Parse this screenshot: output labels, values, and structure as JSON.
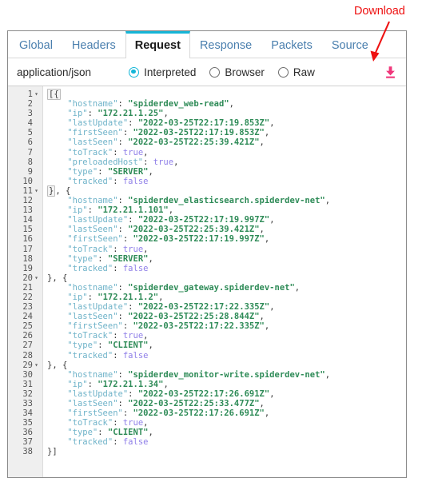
{
  "annotation": {
    "label": "Download",
    "color": "#ee1111"
  },
  "tabs": [
    {
      "label": "Global",
      "active": false
    },
    {
      "label": "Headers",
      "active": false
    },
    {
      "label": "Request",
      "active": true
    },
    {
      "label": "Response",
      "active": false
    },
    {
      "label": "Packets",
      "active": false
    },
    {
      "label": "Source",
      "active": false
    }
  ],
  "options": {
    "content_type": "application/json",
    "radios": [
      {
        "label": "Interpreted",
        "selected": true
      },
      {
        "label": "Browser",
        "selected": false
      },
      {
        "label": "Raw",
        "selected": false
      }
    ],
    "download_icon": "download-icon",
    "download_icon_color": "#f0367a"
  },
  "theme": {
    "accent": "#16b5d6",
    "tab_inactive_text": "#4a7fae",
    "tab_active_text": "#1b1b1b",
    "key_color": "#6fb3c9",
    "string_color": "#2e8b57",
    "bool_color": "#8f7fe8",
    "gutter_bg": "#efefef",
    "panel_border": "#8a8a8a"
  },
  "code": {
    "language": "json",
    "total_lines": 38,
    "lines": [
      {
        "n": 1,
        "fold": true,
        "indent": 0,
        "tokens": [
          {
            "t": "punct",
            "v": "[{",
            "boxed": true
          }
        ]
      },
      {
        "n": 2,
        "fold": false,
        "indent": 4,
        "tokens": [
          {
            "t": "key",
            "v": "\"hostname\""
          },
          {
            "t": "punct",
            "v": ": "
          },
          {
            "t": "string",
            "v": "\"spiderdev_web-read\""
          },
          {
            "t": "punct",
            "v": ","
          }
        ]
      },
      {
        "n": 3,
        "fold": false,
        "indent": 4,
        "tokens": [
          {
            "t": "key",
            "v": "\"ip\""
          },
          {
            "t": "punct",
            "v": ": "
          },
          {
            "t": "string",
            "v": "\"172.21.1.25\""
          },
          {
            "t": "punct",
            "v": ","
          }
        ]
      },
      {
        "n": 4,
        "fold": false,
        "indent": 4,
        "tokens": [
          {
            "t": "key",
            "v": "\"lastUpdate\""
          },
          {
            "t": "punct",
            "v": ": "
          },
          {
            "t": "string",
            "v": "\"2022-03-25T22:17:19.853Z\""
          },
          {
            "t": "punct",
            "v": ","
          }
        ]
      },
      {
        "n": 5,
        "fold": false,
        "indent": 4,
        "tokens": [
          {
            "t": "key",
            "v": "\"firstSeen\""
          },
          {
            "t": "punct",
            "v": ": "
          },
          {
            "t": "string",
            "v": "\"2022-03-25T22:17:19.853Z\""
          },
          {
            "t": "punct",
            "v": ","
          }
        ]
      },
      {
        "n": 6,
        "fold": false,
        "indent": 4,
        "tokens": [
          {
            "t": "key",
            "v": "\"lastSeen\""
          },
          {
            "t": "punct",
            "v": ": "
          },
          {
            "t": "string",
            "v": "\"2022-03-25T22:25:39.421Z\""
          },
          {
            "t": "punct",
            "v": ","
          }
        ]
      },
      {
        "n": 7,
        "fold": false,
        "indent": 4,
        "tokens": [
          {
            "t": "key",
            "v": "\"toTrack\""
          },
          {
            "t": "punct",
            "v": ": "
          },
          {
            "t": "bool",
            "v": "true"
          },
          {
            "t": "punct",
            "v": ","
          }
        ]
      },
      {
        "n": 8,
        "fold": false,
        "indent": 4,
        "tokens": [
          {
            "t": "key",
            "v": "\"preloadedHost\""
          },
          {
            "t": "punct",
            "v": ": "
          },
          {
            "t": "bool",
            "v": "true"
          },
          {
            "t": "punct",
            "v": ","
          }
        ]
      },
      {
        "n": 9,
        "fold": false,
        "indent": 4,
        "tokens": [
          {
            "t": "key",
            "v": "\"type\""
          },
          {
            "t": "punct",
            "v": ": "
          },
          {
            "t": "string",
            "v": "\"SERVER\""
          },
          {
            "t": "punct",
            "v": ","
          }
        ]
      },
      {
        "n": 10,
        "fold": false,
        "indent": 4,
        "tokens": [
          {
            "t": "key",
            "v": "\"tracked\""
          },
          {
            "t": "punct",
            "v": ": "
          },
          {
            "t": "bool",
            "v": "false"
          }
        ]
      },
      {
        "n": 11,
        "fold": true,
        "indent": 0,
        "tokens": [
          {
            "t": "punct",
            "v": "}",
            "boxed": true
          },
          {
            "t": "punct",
            "v": ", {"
          }
        ]
      },
      {
        "n": 12,
        "fold": false,
        "indent": 4,
        "tokens": [
          {
            "t": "key",
            "v": "\"hostname\""
          },
          {
            "t": "punct",
            "v": ": "
          },
          {
            "t": "string",
            "v": "\"spiderdev_elasticsearch.spiderdev-net\""
          },
          {
            "t": "punct",
            "v": ","
          }
        ]
      },
      {
        "n": 13,
        "fold": false,
        "indent": 4,
        "tokens": [
          {
            "t": "key",
            "v": "\"ip\""
          },
          {
            "t": "punct",
            "v": ": "
          },
          {
            "t": "string",
            "v": "\"172.21.1.101\""
          },
          {
            "t": "punct",
            "v": ","
          }
        ]
      },
      {
        "n": 14,
        "fold": false,
        "indent": 4,
        "tokens": [
          {
            "t": "key",
            "v": "\"lastUpdate\""
          },
          {
            "t": "punct",
            "v": ": "
          },
          {
            "t": "string",
            "v": "\"2022-03-25T22:17:19.997Z\""
          },
          {
            "t": "punct",
            "v": ","
          }
        ]
      },
      {
        "n": 15,
        "fold": false,
        "indent": 4,
        "tokens": [
          {
            "t": "key",
            "v": "\"lastSeen\""
          },
          {
            "t": "punct",
            "v": ": "
          },
          {
            "t": "string",
            "v": "\"2022-03-25T22:25:39.421Z\""
          },
          {
            "t": "punct",
            "v": ","
          }
        ]
      },
      {
        "n": 16,
        "fold": false,
        "indent": 4,
        "tokens": [
          {
            "t": "key",
            "v": "\"firstSeen\""
          },
          {
            "t": "punct",
            "v": ": "
          },
          {
            "t": "string",
            "v": "\"2022-03-25T22:17:19.997Z\""
          },
          {
            "t": "punct",
            "v": ","
          }
        ]
      },
      {
        "n": 17,
        "fold": false,
        "indent": 4,
        "tokens": [
          {
            "t": "key",
            "v": "\"toTrack\""
          },
          {
            "t": "punct",
            "v": ": "
          },
          {
            "t": "bool",
            "v": "true"
          },
          {
            "t": "punct",
            "v": ","
          }
        ]
      },
      {
        "n": 18,
        "fold": false,
        "indent": 4,
        "tokens": [
          {
            "t": "key",
            "v": "\"type\""
          },
          {
            "t": "punct",
            "v": ": "
          },
          {
            "t": "string",
            "v": "\"SERVER\""
          },
          {
            "t": "punct",
            "v": ","
          }
        ]
      },
      {
        "n": 19,
        "fold": false,
        "indent": 4,
        "tokens": [
          {
            "t": "key",
            "v": "\"tracked\""
          },
          {
            "t": "punct",
            "v": ": "
          },
          {
            "t": "bool",
            "v": "false"
          }
        ]
      },
      {
        "n": 20,
        "fold": true,
        "indent": 0,
        "tokens": [
          {
            "t": "punct",
            "v": "}, {"
          }
        ]
      },
      {
        "n": 21,
        "fold": false,
        "indent": 4,
        "tokens": [
          {
            "t": "key",
            "v": "\"hostname\""
          },
          {
            "t": "punct",
            "v": ": "
          },
          {
            "t": "string",
            "v": "\"spiderdev_gateway.spiderdev-net\""
          },
          {
            "t": "punct",
            "v": ","
          }
        ]
      },
      {
        "n": 22,
        "fold": false,
        "indent": 4,
        "tokens": [
          {
            "t": "key",
            "v": "\"ip\""
          },
          {
            "t": "punct",
            "v": ": "
          },
          {
            "t": "string",
            "v": "\"172.21.1.2\""
          },
          {
            "t": "punct",
            "v": ","
          }
        ]
      },
      {
        "n": 23,
        "fold": false,
        "indent": 4,
        "tokens": [
          {
            "t": "key",
            "v": "\"lastUpdate\""
          },
          {
            "t": "punct",
            "v": ": "
          },
          {
            "t": "string",
            "v": "\"2022-03-25T22:17:22.335Z\""
          },
          {
            "t": "punct",
            "v": ","
          }
        ]
      },
      {
        "n": 24,
        "fold": false,
        "indent": 4,
        "tokens": [
          {
            "t": "key",
            "v": "\"lastSeen\""
          },
          {
            "t": "punct",
            "v": ": "
          },
          {
            "t": "string",
            "v": "\"2022-03-25T22:25:28.844Z\""
          },
          {
            "t": "punct",
            "v": ","
          }
        ]
      },
      {
        "n": 25,
        "fold": false,
        "indent": 4,
        "tokens": [
          {
            "t": "key",
            "v": "\"firstSeen\""
          },
          {
            "t": "punct",
            "v": ": "
          },
          {
            "t": "string",
            "v": "\"2022-03-25T22:17:22.335Z\""
          },
          {
            "t": "punct",
            "v": ","
          }
        ]
      },
      {
        "n": 26,
        "fold": false,
        "indent": 4,
        "tokens": [
          {
            "t": "key",
            "v": "\"toTrack\""
          },
          {
            "t": "punct",
            "v": ": "
          },
          {
            "t": "bool",
            "v": "true"
          },
          {
            "t": "punct",
            "v": ","
          }
        ]
      },
      {
        "n": 27,
        "fold": false,
        "indent": 4,
        "tokens": [
          {
            "t": "key",
            "v": "\"type\""
          },
          {
            "t": "punct",
            "v": ": "
          },
          {
            "t": "string",
            "v": "\"CLIENT\""
          },
          {
            "t": "punct",
            "v": ","
          }
        ]
      },
      {
        "n": 28,
        "fold": false,
        "indent": 4,
        "tokens": [
          {
            "t": "key",
            "v": "\"tracked\""
          },
          {
            "t": "punct",
            "v": ": "
          },
          {
            "t": "bool",
            "v": "false"
          }
        ]
      },
      {
        "n": 29,
        "fold": true,
        "indent": 0,
        "tokens": [
          {
            "t": "punct",
            "v": "}, {"
          }
        ]
      },
      {
        "n": 30,
        "fold": false,
        "indent": 4,
        "tokens": [
          {
            "t": "key",
            "v": "\"hostname\""
          },
          {
            "t": "punct",
            "v": ": "
          },
          {
            "t": "string",
            "v": "\"spiderdev_monitor-write.spiderdev-net\""
          },
          {
            "t": "punct",
            "v": ","
          }
        ]
      },
      {
        "n": 31,
        "fold": false,
        "indent": 4,
        "tokens": [
          {
            "t": "key",
            "v": "\"ip\""
          },
          {
            "t": "punct",
            "v": ": "
          },
          {
            "t": "string",
            "v": "\"172.21.1.34\""
          },
          {
            "t": "punct",
            "v": ","
          }
        ]
      },
      {
        "n": 32,
        "fold": false,
        "indent": 4,
        "tokens": [
          {
            "t": "key",
            "v": "\"lastUpdate\""
          },
          {
            "t": "punct",
            "v": ": "
          },
          {
            "t": "string",
            "v": "\"2022-03-25T22:17:26.691Z\""
          },
          {
            "t": "punct",
            "v": ","
          }
        ]
      },
      {
        "n": 33,
        "fold": false,
        "indent": 4,
        "tokens": [
          {
            "t": "key",
            "v": "\"lastSeen\""
          },
          {
            "t": "punct",
            "v": ": "
          },
          {
            "t": "string",
            "v": "\"2022-03-25T22:25:33.477Z\""
          },
          {
            "t": "punct",
            "v": ","
          }
        ]
      },
      {
        "n": 34,
        "fold": false,
        "indent": 4,
        "tokens": [
          {
            "t": "key",
            "v": "\"firstSeen\""
          },
          {
            "t": "punct",
            "v": ": "
          },
          {
            "t": "string",
            "v": "\"2022-03-25T22:17:26.691Z\""
          },
          {
            "t": "punct",
            "v": ","
          }
        ]
      },
      {
        "n": 35,
        "fold": false,
        "indent": 4,
        "tokens": [
          {
            "t": "key",
            "v": "\"toTrack\""
          },
          {
            "t": "punct",
            "v": ": "
          },
          {
            "t": "bool",
            "v": "true"
          },
          {
            "t": "punct",
            "v": ","
          }
        ]
      },
      {
        "n": 36,
        "fold": false,
        "indent": 4,
        "tokens": [
          {
            "t": "key",
            "v": "\"type\""
          },
          {
            "t": "punct",
            "v": ": "
          },
          {
            "t": "string",
            "v": "\"CLIENT\""
          },
          {
            "t": "punct",
            "v": ","
          }
        ]
      },
      {
        "n": 37,
        "fold": false,
        "indent": 4,
        "tokens": [
          {
            "t": "key",
            "v": "\"tracked\""
          },
          {
            "t": "punct",
            "v": ": "
          },
          {
            "t": "bool",
            "v": "false"
          }
        ]
      },
      {
        "n": 38,
        "fold": false,
        "indent": 0,
        "tokens": [
          {
            "t": "punct",
            "v": "}]"
          }
        ]
      }
    ]
  }
}
